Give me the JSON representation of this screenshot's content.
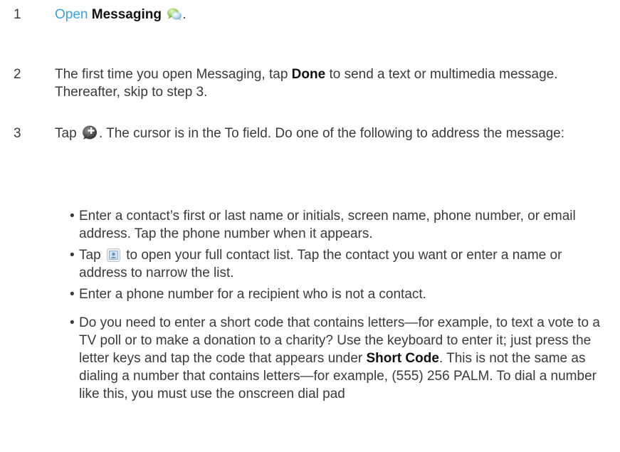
{
  "steps": [
    {
      "number": "1",
      "open_word": "Open",
      "app_name": "Messaging",
      "end": "."
    },
    {
      "number": "2",
      "text_before": "The first time you open Messaging, tap ",
      "keyword": "Done",
      "text_after": " to send a text or multimedia message. Thereafter, skip to step 3."
    },
    {
      "number": "3",
      "text_before": "Tap ",
      "text_after": ". The cursor is in the To field. Do one of the following to address the message:"
    }
  ],
  "bullets": {
    "dot": "•",
    "b1": "Enter a contact’s first or last name or initials, screen name, phone number, or email address. Tap the phone number when it appears.",
    "b2_before": "Tap ",
    "b2_after": " to open your full contact list. Tap the contact you want or enter a name or address to narrow the list.",
    "b3": "Enter a phone number for a recipient who is not a contact.",
    "b4_before": "Do you need to enter a short code that contains letters—for example, to text a vote to a TV poll or to make a donation to a charity? Use the keyboard to enter it; just press the letter keys and tap the code that appears under ",
    "b4_keyword": "Short Code",
    "b4_after": ". This is not the same as dialing a number that contains letters—for example, (555) 256 PALM. To dial a number like this, you must use the onscreen dial pad"
  },
  "icons": {
    "messaging": "messaging-app-icon",
    "new_message": "new-message-icon",
    "contacts": "contacts-icon"
  },
  "colors": {
    "link": "#3ba3dc",
    "body_text": "#3a3a3a",
    "bold_text": "#111111"
  }
}
